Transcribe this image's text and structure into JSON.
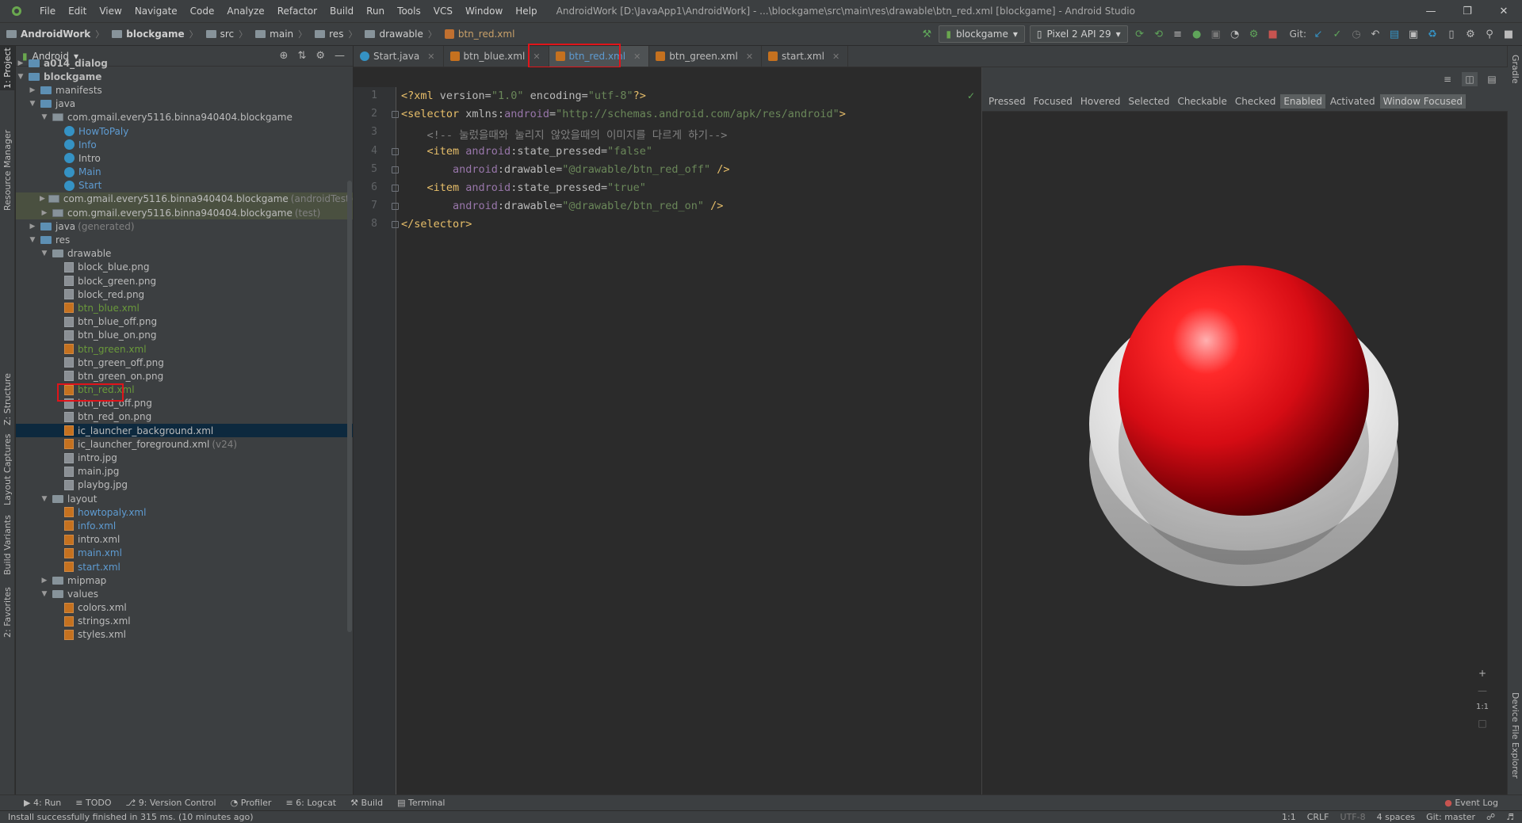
{
  "menubar": {
    "items": [
      "File",
      "Edit",
      "View",
      "Navigate",
      "Code",
      "Analyze",
      "Refactor",
      "Build",
      "Run",
      "Tools",
      "VCS",
      "Window",
      "Help"
    ],
    "window_title": "AndroidWork [D:\\JavaApp1\\AndroidWork] - ...\\blockgame\\src\\main\\res\\drawable\\btn_red.xml [blockgame] - Android Studio"
  },
  "navbar": {
    "crumbs": [
      "AndroidWork",
      "blockgame",
      "src",
      "main",
      "res",
      "drawable",
      "btn_red.xml"
    ],
    "module": "blockgame",
    "device": "Pixel 2 API 29",
    "git_label": "Git:"
  },
  "project": {
    "view_selector": "Android",
    "tree": [
      {
        "label": "a014_dialog",
        "depth": 0,
        "arrow": "closed",
        "icon": "folder-blue",
        "bold": true
      },
      {
        "label": "blockgame",
        "depth": 0,
        "arrow": "open",
        "icon": "folder-blue",
        "bold": true
      },
      {
        "label": "manifests",
        "depth": 1,
        "arrow": "closed",
        "icon": "folder-blue"
      },
      {
        "label": "java",
        "depth": 1,
        "arrow": "open",
        "icon": "folder-blue"
      },
      {
        "label": "com.gmail.every5116.binna940404.blockgame",
        "depth": 2,
        "arrow": "open",
        "icon": "package"
      },
      {
        "label": "HowToPaly",
        "depth": 3,
        "arrow": "none",
        "icon": "class",
        "color": "blue"
      },
      {
        "label": "Info",
        "depth": 3,
        "arrow": "none",
        "icon": "class",
        "color": "blue"
      },
      {
        "label": "Intro",
        "depth": 3,
        "arrow": "none",
        "icon": "class"
      },
      {
        "label": "Main",
        "depth": 3,
        "arrow": "none",
        "icon": "class",
        "color": "blue"
      },
      {
        "label": "Start",
        "depth": 3,
        "arrow": "none",
        "icon": "class",
        "color": "blue"
      },
      {
        "label": "com.gmail.every5116.binna940404.blockgame",
        "hint": "(androidTest)",
        "depth": 2,
        "arrow": "closed",
        "icon": "package",
        "gray": true
      },
      {
        "label": "com.gmail.every5116.binna940404.blockgame",
        "hint": "(test)",
        "depth": 2,
        "arrow": "closed",
        "icon": "package",
        "gray": true
      },
      {
        "label": "java",
        "hint": "(generated)",
        "depth": 1,
        "arrow": "closed",
        "icon": "folder-blue"
      },
      {
        "label": "res",
        "depth": 1,
        "arrow": "open",
        "icon": "folder-blue"
      },
      {
        "label": "drawable",
        "depth": 2,
        "arrow": "open",
        "icon": "folder"
      },
      {
        "label": "block_blue.png",
        "depth": 3,
        "arrow": "none",
        "icon": "png"
      },
      {
        "label": "block_green.png",
        "depth": 3,
        "arrow": "none",
        "icon": "png"
      },
      {
        "label": "block_red.png",
        "depth": 3,
        "arrow": "none",
        "icon": "png"
      },
      {
        "label": "btn_blue.xml",
        "depth": 3,
        "arrow": "none",
        "icon": "xml",
        "color": "green"
      },
      {
        "label": "btn_blue_off.png",
        "depth": 3,
        "arrow": "none",
        "icon": "png"
      },
      {
        "label": "btn_blue_on.png",
        "depth": 3,
        "arrow": "none",
        "icon": "png"
      },
      {
        "label": "btn_green.xml",
        "depth": 3,
        "arrow": "none",
        "icon": "xml",
        "color": "green"
      },
      {
        "label": "btn_green_off.png",
        "depth": 3,
        "arrow": "none",
        "icon": "png"
      },
      {
        "label": "btn_green_on.png",
        "depth": 3,
        "arrow": "none",
        "icon": "png"
      },
      {
        "label": "btn_red.xml",
        "depth": 3,
        "arrow": "none",
        "icon": "xml",
        "color": "green",
        "highlight": true
      },
      {
        "label": "btn_red_off.png",
        "depth": 3,
        "arrow": "none",
        "icon": "png"
      },
      {
        "label": "btn_red_on.png",
        "depth": 3,
        "arrow": "none",
        "icon": "png"
      },
      {
        "label": "ic_launcher_background.xml",
        "depth": 3,
        "arrow": "none",
        "icon": "xml",
        "selected": true
      },
      {
        "label": "ic_launcher_foreground.xml",
        "hint": "(v24)",
        "depth": 3,
        "arrow": "none",
        "icon": "xml"
      },
      {
        "label": "intro.jpg",
        "depth": 3,
        "arrow": "none",
        "icon": "png"
      },
      {
        "label": "main.jpg",
        "depth": 3,
        "arrow": "none",
        "icon": "png"
      },
      {
        "label": "playbg.jpg",
        "depth": 3,
        "arrow": "none",
        "icon": "png"
      },
      {
        "label": "layout",
        "depth": 2,
        "arrow": "open",
        "icon": "folder"
      },
      {
        "label": "howtopaly.xml",
        "depth": 3,
        "arrow": "none",
        "icon": "xml",
        "color": "blue"
      },
      {
        "label": "info.xml",
        "depth": 3,
        "arrow": "none",
        "icon": "xml",
        "color": "blue"
      },
      {
        "label": "intro.xml",
        "depth": 3,
        "arrow": "none",
        "icon": "xml"
      },
      {
        "label": "main.xml",
        "depth": 3,
        "arrow": "none",
        "icon": "xml",
        "color": "blue"
      },
      {
        "label": "start.xml",
        "depth": 3,
        "arrow": "none",
        "icon": "xml",
        "color": "blue"
      },
      {
        "label": "mipmap",
        "depth": 2,
        "arrow": "closed",
        "icon": "folder"
      },
      {
        "label": "values",
        "depth": 2,
        "arrow": "open",
        "icon": "folder"
      },
      {
        "label": "colors.xml",
        "depth": 3,
        "arrow": "none",
        "icon": "xml"
      },
      {
        "label": "strings.xml",
        "depth": 3,
        "arrow": "none",
        "icon": "xml"
      },
      {
        "label": "styles.xml",
        "depth": 3,
        "arrow": "none",
        "icon": "xml"
      }
    ]
  },
  "side_tabs": {
    "left": [
      "1: Project",
      "Resource Manager",
      "Z: Structure",
      "Layout Captures",
      "Build Variants",
      "2: Favorites"
    ],
    "right": [
      "Gradle",
      "Device File Explorer"
    ]
  },
  "tabs": [
    {
      "label": "Start.java",
      "icon": "java"
    },
    {
      "label": "btn_blue.xml",
      "icon": "xml"
    },
    {
      "label": "btn_red.xml",
      "icon": "xml",
      "active": true
    },
    {
      "label": "btn_green.xml",
      "icon": "xml"
    },
    {
      "label": "start.xml",
      "icon": "xml"
    }
  ],
  "editor": {
    "line_numbers": [
      "1",
      "2",
      "3",
      "4",
      "5",
      "6",
      "7",
      "8"
    ],
    "lines": [
      [
        [
          "pi",
          "<?xml "
        ],
        [
          "attr",
          "version="
        ],
        [
          "val",
          "\"1.0\""
        ],
        [
          "attr",
          " encoding="
        ],
        [
          "val",
          "\"utf-8\""
        ],
        [
          "pi",
          "?>"
        ]
      ],
      [
        [
          "tag",
          "<selector "
        ],
        [
          "attr",
          "xmlns:"
        ],
        [
          "ns",
          "android"
        ],
        [
          "attr",
          "="
        ],
        [
          "val",
          "\"http://schemas.android.com/apk/res/android\""
        ],
        [
          "tag",
          ">"
        ]
      ],
      [
        [
          "com",
          "    <!-- 눌렀을때와 눌리지 않았을때의 이미지를 다르게 하기-->"
        ]
      ],
      [
        [
          "tag",
          "    <item "
        ],
        [
          "ns",
          "android"
        ],
        [
          "attr",
          ":state_pressed="
        ],
        [
          "val",
          "\"false\""
        ]
      ],
      [
        [
          "ns",
          "        android"
        ],
        [
          "attr",
          ":drawable="
        ],
        [
          "val",
          "\"@drawable/btn_red_off\""
        ],
        [
          "tag",
          " />"
        ]
      ],
      [
        [
          "tag",
          "    <item "
        ],
        [
          "ns",
          "android"
        ],
        [
          "attr",
          ":state_pressed="
        ],
        [
          "val",
          "\"true\""
        ]
      ],
      [
        [
          "ns",
          "        android"
        ],
        [
          "attr",
          ":drawable="
        ],
        [
          "val",
          "\"@drawable/btn_red_on\""
        ],
        [
          "tag",
          " />"
        ]
      ],
      [
        [
          "tag",
          "</selector>"
        ]
      ]
    ]
  },
  "preview": {
    "states": [
      {
        "label": "Pressed",
        "on": false
      },
      {
        "label": "Focused",
        "on": false
      },
      {
        "label": "Hovered",
        "on": false
      },
      {
        "label": "Selected",
        "on": false
      },
      {
        "label": "Checkable",
        "on": false
      },
      {
        "label": "Checked",
        "on": false
      },
      {
        "label": "Enabled",
        "on": true
      },
      {
        "label": "Activated",
        "on": false
      },
      {
        "label": "Window Focused",
        "on": true
      }
    ],
    "zoom_label": "1:1"
  },
  "bottom_tools": [
    "4: Run",
    "TODO",
    "9: Version Control",
    "Profiler",
    "6: Logcat",
    "Build",
    "Terminal"
  ],
  "event_log": "Event Log",
  "status": {
    "message": "Install successfully finished in 315 ms. (10 minutes ago)",
    "position": "1:1",
    "line_sep": "CRLF",
    "encoding": "UTF-8",
    "indent": "4 spaces",
    "vcs": "Git: master"
  },
  "colors": {
    "highlight_box": "#e0141a",
    "button_red": "#e8141c",
    "button_base": "#e6e6e6"
  }
}
